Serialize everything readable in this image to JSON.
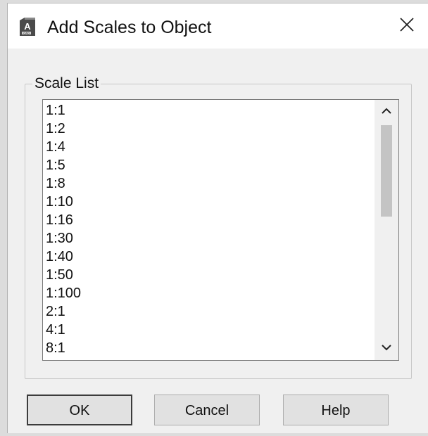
{
  "window": {
    "title": "Add Scales to Object",
    "app_icon": "autocad-app-icon",
    "close_icon": "close-icon"
  },
  "scale_list": {
    "legend": "Scale List",
    "items": [
      "1:1",
      "1:2",
      "1:4",
      "1:5",
      "1:8",
      "1:10",
      "1:16",
      "1:30",
      "1:40",
      "1:50",
      "1:100",
      "2:1",
      "4:1",
      "8:1"
    ],
    "scroll_up_icon": "chevron-up-icon",
    "scroll_down_icon": "chevron-down-icon"
  },
  "buttons": {
    "ok_label": "OK",
    "cancel_label": "Cancel",
    "help_label": "Help"
  },
  "colors": {
    "dialog_background": "#f0f0f0",
    "titlebar_background": "#ffffff",
    "list_background": "#ffffff",
    "button_face": "#e1e1e1",
    "default_button_border": "#3c3c3c"
  }
}
